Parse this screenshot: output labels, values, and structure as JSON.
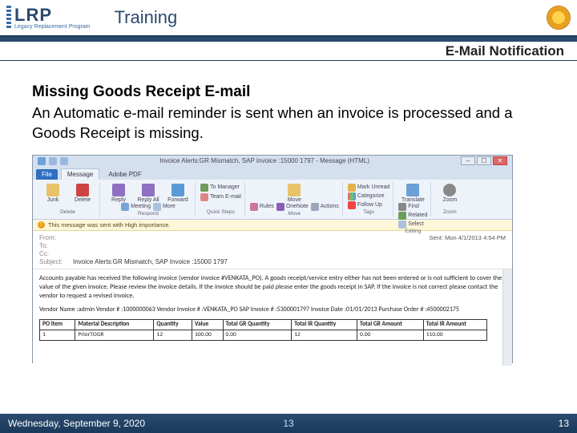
{
  "header": {
    "lrp": "LRP",
    "lrp_sub": "Legacy Replacement Program",
    "training": "Training"
  },
  "subtitle": "E-Mail Notification",
  "section": {
    "title": "Missing Goods Receipt  E-mail",
    "body": "An Automatic e-mail reminder is sent when an invoice is processed and a Goods Receipt is missing."
  },
  "outlook": {
    "window_title": "Invoice Alerts:GR Mismatch, SAP Invoice :15000 1797 - Message (HTML)",
    "tabs": {
      "file": "File",
      "message": "Message",
      "adobe": "Adobe PDF"
    },
    "ribbon": {
      "delete": {
        "junk": "Junk",
        "delete": "Delete",
        "label": "Delete"
      },
      "respond": {
        "reply": "Reply",
        "reply_all": "Reply All",
        "forward": "Forward",
        "meeting": "Meeting",
        "more": "More",
        "label": "Respond"
      },
      "quick": {
        "to_manager": "To Manager",
        "team_email": "Team E-mail",
        "label": "Quick Steps"
      },
      "move": {
        "move": "Move",
        "rules": "Rules",
        "onenote": "OneNote",
        "actions": "Actions",
        "label": "Move"
      },
      "tags": {
        "unread": "Mark Unread",
        "categorize": "Categorize",
        "followup": "Follow Up",
        "label": "Tags"
      },
      "editing": {
        "translate": "Translate",
        "find": "Find",
        "related": "Related",
        "select": "Select",
        "label": "Editing"
      },
      "zoom": {
        "zoom": "Zoom",
        "label": "Zoom"
      }
    },
    "info_bar": "This message was sent with High importance.",
    "fields": {
      "from_label": "From:",
      "to_label": "To:",
      "cc_label": "Cc:",
      "subject_label": "Subject:",
      "subject_value": "Invoice Alerts:GR Mismatch, SAP Invoice :15000 1797",
      "sent": "Sent: Mon 4/1/2013 4:54 PM"
    },
    "body": {
      "para": "Accounts payable has received the following invoice (vendor invoice #VENKATA_PO). A goods receipt/service entry either has not been entered or is not sufficient to cover the value of the given invoice. Please review the invoice details. If the invoice should be paid please enter the goods receipt in SAP. If the invoice is not correct please contact the vendor to request a revised invoice.",
      "kv": "Vendor Name :admin Vendor # :1000000063 Vendor Invoice # :VENKATA_PO SAP Invoice # :5300001797 Invoice Date :01/01/2013 Purchase Order # :4500002175",
      "table": {
        "headers": [
          "PO Item",
          "Material Description",
          "Quantity",
          "Value",
          "Total GR Quantity",
          "Total IR Quantity",
          "Total GR Amount",
          "Total IR Amount"
        ],
        "row": [
          "1",
          "PriorTOGR",
          "12",
          "100.00",
          "0.00",
          "12",
          "0.00",
          "110.00"
        ]
      }
    }
  },
  "footer": {
    "date": "Wednesday, September 9, 2020",
    "page_center": "13",
    "page_right": "13"
  }
}
